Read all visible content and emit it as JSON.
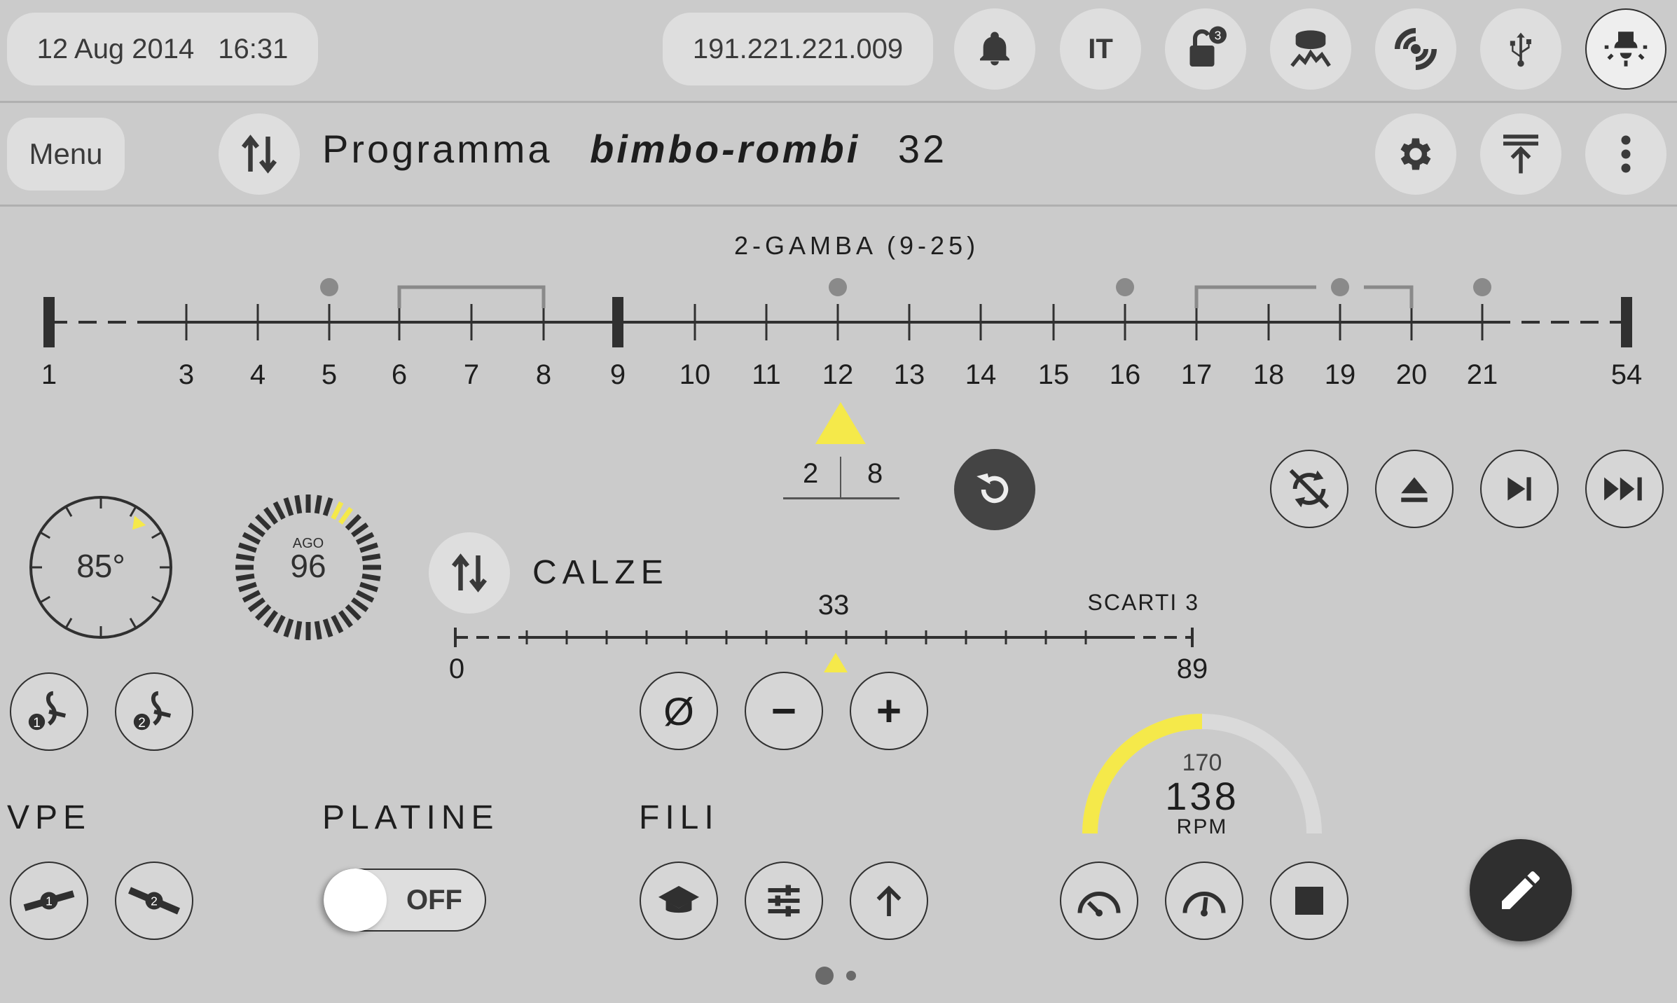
{
  "status_bar": {
    "date": "12 Aug 2014",
    "time": "16:31",
    "ip": "191.221.221.009",
    "language": "IT",
    "lock_badge": "3",
    "icons": [
      "bell-icon",
      "lock-icon",
      "sensor-icon",
      "network-icon",
      "usb-icon",
      "lamp-icon"
    ]
  },
  "toolbar": {
    "menu_label": "Menu",
    "program_prefix": "Programma",
    "program_name": "bimbo-rombi",
    "program_number": "32",
    "icons": [
      "swap-icon",
      "gear-icon",
      "upload-icon",
      "more-icon"
    ]
  },
  "sequence": {
    "title": "2-GAMBA (9-25)",
    "ticks": [
      "1",
      "3",
      "4",
      "5",
      "6",
      "7",
      "8",
      "9",
      "10",
      "11",
      "12",
      "13",
      "14",
      "15",
      "16",
      "17",
      "18",
      "19",
      "20",
      "21",
      "54"
    ],
    "dots_at": [
      5,
      12,
      16,
      19,
      21
    ],
    "brackets": [
      [
        6,
        8
      ],
      [
        17,
        20
      ]
    ],
    "current": 12,
    "counter_left": "2",
    "counter_right": "8"
  },
  "dial_angle": {
    "value": "85°",
    "indicator_deg": 40
  },
  "dial_needle": {
    "label": "AGO",
    "value": "96"
  },
  "calze": {
    "label": "CALZE",
    "min": "0",
    "max": "89",
    "current": "33",
    "scarti": "SCARTI 3"
  },
  "counter_buttons": [
    "Ø",
    "−",
    "+"
  ],
  "sections": {
    "vpe": "VPE",
    "platine": "PLATINE",
    "fili": "FILI"
  },
  "platine_toggle": {
    "state": "OFF"
  },
  "speed": {
    "max": "170",
    "value": "138",
    "unit": "RPM",
    "fraction": 0.5
  },
  "colors": {
    "background": "#cbcbcb",
    "accent_yellow": "#f5e94a",
    "dark": "#303030",
    "button_bg": "#dedede"
  },
  "pager": {
    "pages": 2,
    "active": 1
  }
}
